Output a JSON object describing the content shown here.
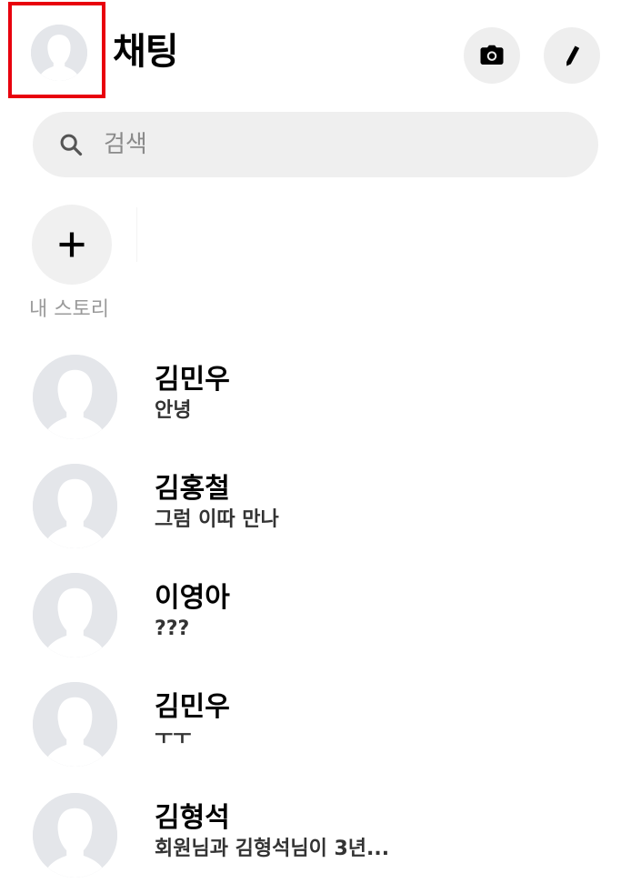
{
  "header": {
    "title": "채팅"
  },
  "search": {
    "placeholder": "검색"
  },
  "stories": {
    "my_story_label": "내 스토리"
  },
  "chats": [
    {
      "name": "김민우",
      "preview": "안녕"
    },
    {
      "name": "김홍철",
      "preview": "그럼 이따 만나"
    },
    {
      "name": "이영아",
      "preview": "???"
    },
    {
      "name": "김민우",
      "preview": "ㅜㅜ"
    },
    {
      "name": "김형석",
      "preview": "회원님과 김형석님이 3년..."
    }
  ],
  "colors": {
    "highlight_border": "#e8000d",
    "avatar_bg": "#e4e6ea",
    "avatar_silhouette": "#ffffff"
  },
  "icons": [
    "profile-avatar-icon",
    "camera-icon",
    "pencil-icon",
    "search-icon",
    "plus-icon"
  ]
}
